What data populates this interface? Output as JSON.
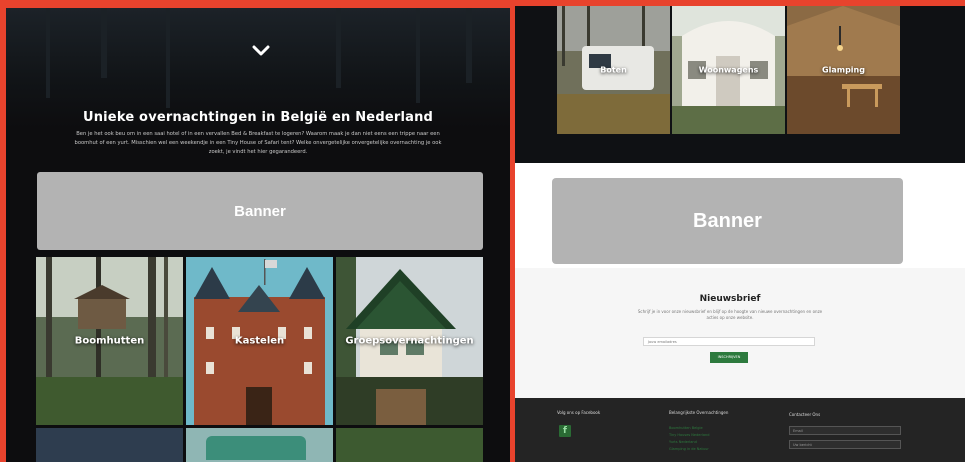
{
  "left": {
    "heading": "Unieke overnachtingen in België en Nederland",
    "intro": "Ben je het ook beu om in een saai hotel of in een vervallen Bed & Breakfast te logeren? Waarom maak je dan niet eens een trippe naar een boomhut of een yurt. Misschien wel een weekendje in een Tiny House of Safari tent? Welke onvergetelijke onvergetelijke overnachting je ook zoekt, je vindt het hier gegarandeerd.",
    "banner": "Banner",
    "tiles": [
      {
        "label": "Boomhutten",
        "icon": "treehouse-photo"
      },
      {
        "label": "Kastelen",
        "icon": "castle-photo"
      },
      {
        "label": "Groepsovernachtingen",
        "icon": "chalet-photo"
      }
    ]
  },
  "right": {
    "tiles": [
      {
        "label": "Boten",
        "icon": "caravan-photo"
      },
      {
        "label": "Woonwagens",
        "icon": "wagon-photo"
      },
      {
        "label": "Glamping",
        "icon": "tent-photo"
      }
    ],
    "banner": "Banner",
    "newsletter": {
      "title": "Nieuwsbrief",
      "text": "Schrijf je in voor onze nieuwsbrief en blijf op de hoogte van nieuwe overnachtingen en onze acties op onze website.",
      "input_placeholder": "Jouw emailadres",
      "button": "INSCHRIJVEN"
    },
    "footer": {
      "col1_title": "Volg ons op Facebook",
      "col2_title": "Belangrijkste Overnachtingen",
      "col2_links": [
        "Boomhutten Belgie",
        "Tiny Houses Nederland",
        "Yurts Nederland",
        "Glamping in de Natuur"
      ],
      "col3_title": "Contacteer Ons",
      "email_placeholder": "Email",
      "message_placeholder": "Uw bericht"
    }
  },
  "colors": {
    "frame": "#e8432d",
    "banner": "#b3b3b3",
    "accent_green": "#2d7a3e"
  }
}
